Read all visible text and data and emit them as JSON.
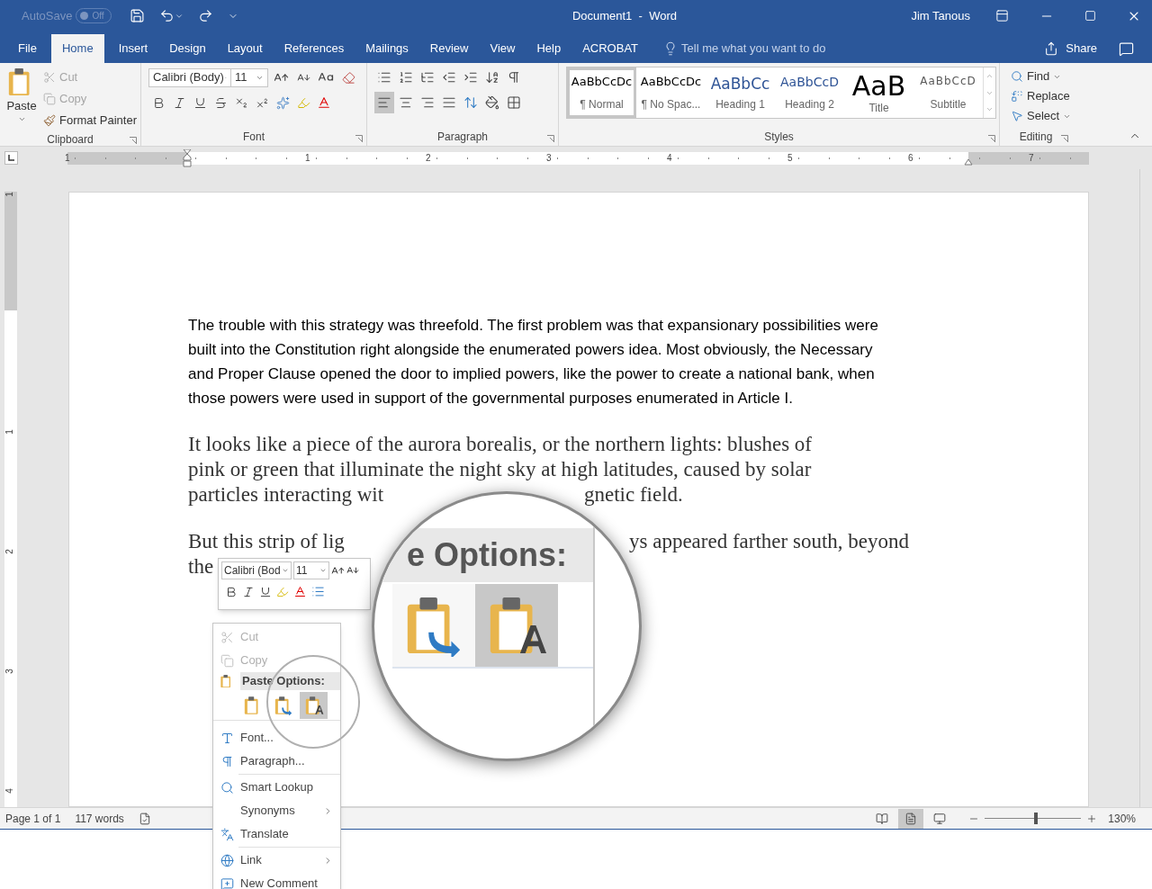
{
  "title_bar": {
    "autosave_label": "AutoSave",
    "autosave_on": false,
    "autosave_state": "Off",
    "title": "Document1  -  Word",
    "user": "Jim Tanous"
  },
  "tabs": [
    {
      "label": "File",
      "selected": false
    },
    {
      "label": "Home",
      "selected": true
    },
    {
      "label": "Insert",
      "selected": false
    },
    {
      "label": "Design",
      "selected": false
    },
    {
      "label": "Layout",
      "selected": false
    },
    {
      "label": "References",
      "selected": false
    },
    {
      "label": "Mailings",
      "selected": false
    },
    {
      "label": "Review",
      "selected": false
    },
    {
      "label": "View",
      "selected": false
    },
    {
      "label": "Help",
      "selected": false
    },
    {
      "label": "ACROBAT",
      "selected": false
    }
  ],
  "tell_me": {
    "placeholder": "Tell me what you want to do"
  },
  "share": "Share",
  "ribbon": {
    "clipboard": {
      "group": "Clipboard",
      "paste": "Paste",
      "items": [
        {
          "label": "Cut",
          "disabled": true
        },
        {
          "label": "Copy",
          "disabled": true
        },
        {
          "label": "Format Painter",
          "disabled": false
        }
      ]
    },
    "font": {
      "group": "Font",
      "font_name": "Calibri (Body)",
      "font_size": "11"
    },
    "paragraph": {
      "group": "Paragraph",
      "alignment": [
        {
          "selected": true
        },
        {
          "selected": false
        },
        {
          "selected": false
        },
        {
          "selected": false
        }
      ]
    },
    "styles": {
      "group": "Styles",
      "items": [
        {
          "kind": "normal",
          "preview": "AaBbCcDc",
          "name": "¶ Normal",
          "selected": true
        },
        {
          "kind": "nospacing",
          "preview": "AaBbCcDc",
          "name": "¶ No Spac...",
          "selected": false
        },
        {
          "kind": "heading1",
          "preview": "AaBbCc",
          "name": "Heading 1",
          "selected": false
        },
        {
          "kind": "heading2",
          "preview": "AaBbCcD",
          "name": "Heading 2",
          "selected": false
        },
        {
          "kind": "title",
          "preview": "AaB",
          "name": "Title",
          "selected": false
        },
        {
          "kind": "subtitle",
          "preview": "AaBbCcD",
          "name": "Subtitle",
          "selected": false
        }
      ]
    },
    "editing": {
      "group": "Editing",
      "items": [
        {
          "kind": "find",
          "label": "Find"
        },
        {
          "kind": "replace",
          "label": "Replace"
        },
        {
          "kind": "select",
          "label": "Select"
        }
      ]
    }
  },
  "ruler": {
    "numbers": [
      "1",
      "1",
      "2",
      "3",
      "4",
      "5",
      "6",
      "7"
    ]
  },
  "vertical_ruler": {
    "numbers": [
      "1",
      "1",
      "2",
      "3",
      "4"
    ]
  },
  "document": {
    "paragraphs": [
      {
        "kind": "sans",
        "lines": [
          [
            "The trouble with this strategy was threefold. The first problem was that expansionary possibilities were"
          ],
          [
            "built into the Constitution right alongside the enumerated powers idea. Most obviously, the Necessary"
          ],
          [
            "and Proper Clause opened the door to implied powers, like the power to create a national bank, when"
          ],
          [
            "those powers were used in support of the governmental purposes enumerated in Article I."
          ]
        ]
      },
      {
        "kind": "serif",
        "lines": [
          [
            "It looks like a piece of the aurora borealis, or the northern lights: blushes of"
          ],
          [
            "pink or green that illuminate the night sky at high latitudes, caused by solar"
          ],
          [
            "particles interacting wit",
            "gnetic field."
          ]
        ]
      },
      {
        "kind": "serif",
        "lines": [
          [
            "But this strip of lig",
            "ys appeared farther south, beyond"
          ],
          [
            "the"
          ]
        ]
      }
    ]
  },
  "mini_toolbar": {
    "font_name": "Calibri (Bod",
    "font_size": "11"
  },
  "context_menu": [
    {
      "kind": "cut",
      "label": "Cut",
      "disabled": true,
      "submenu": false
    },
    {
      "kind": "copy",
      "label": "Copy",
      "disabled": true,
      "submenu": false
    },
    {
      "kind": "header",
      "label": "Paste Options:"
    },
    {
      "kind": "paste",
      "options": [
        {
          "selected": false
        },
        {
          "selected": false
        },
        {
          "selected": true
        }
      ]
    },
    {
      "kind": "font",
      "label": "Font...",
      "disabled": false,
      "submenu": false
    },
    {
      "kind": "paragraph",
      "label": "Paragraph...",
      "disabled": false,
      "submenu": false
    },
    {
      "kind": "lookup",
      "label": "Smart Lookup",
      "disabled": false,
      "submenu": false
    },
    {
      "kind": "plain",
      "label": "Synonyms",
      "disabled": false,
      "submenu": true
    },
    {
      "kind": "translate",
      "label": "Translate",
      "disabled": false,
      "submenu": false
    },
    {
      "kind": "link",
      "label": "Link",
      "disabled": false,
      "submenu": true
    },
    {
      "kind": "comment",
      "label": "New Comment",
      "disabled": false,
      "submenu": false
    }
  ],
  "magnifier": {
    "heading": "e Options:",
    "options": [
      {
        "selected": false
      },
      {
        "selected": true
      }
    ]
  },
  "status_bar": {
    "page": "Page 1 of 1",
    "words": "117 words",
    "views": [
      {
        "selected": false
      },
      {
        "selected": true
      },
      {
        "selected": false
      }
    ],
    "zoom": {
      "level": 0.53,
      "text": "130%"
    }
  }
}
